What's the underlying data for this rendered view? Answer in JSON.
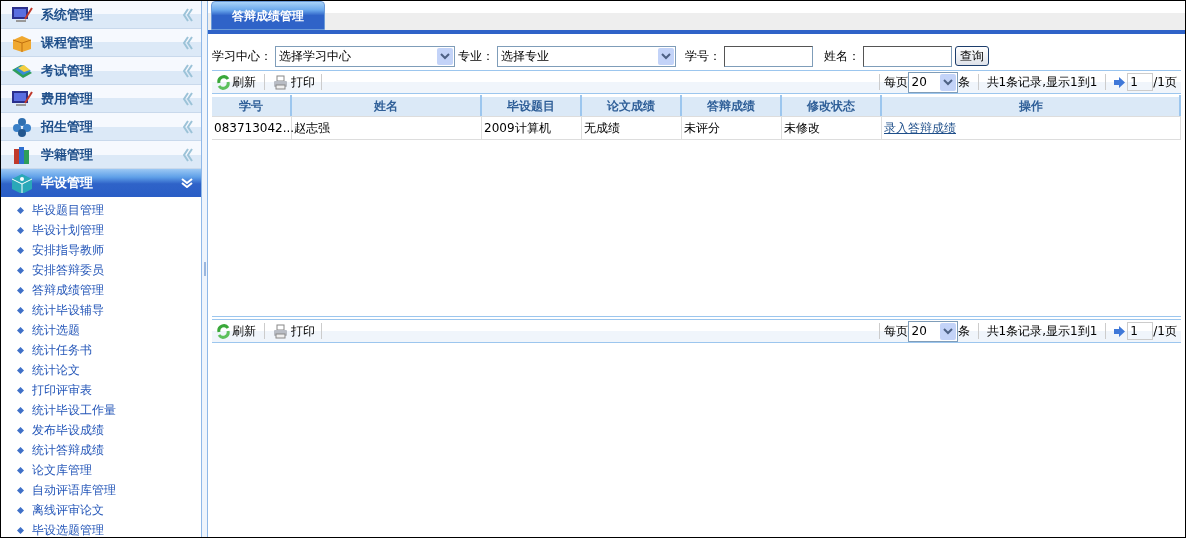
{
  "sidebar": {
    "sections": [
      {
        "label": "系统管理",
        "expanded": false
      },
      {
        "label": "课程管理",
        "expanded": false
      },
      {
        "label": "考试管理",
        "expanded": false
      },
      {
        "label": "费用管理",
        "expanded": false
      },
      {
        "label": "招生管理",
        "expanded": false
      },
      {
        "label": "学籍管理",
        "expanded": false
      },
      {
        "label": "毕设管理",
        "expanded": true,
        "children": [
          "毕设题目管理",
          "毕设计划管理",
          "安排指导教师",
          "安排答辩委员",
          "答辩成绩管理",
          "统计毕设辅导",
          "统计选题",
          "统计任务书",
          "统计论文",
          "打印评审表",
          "统计毕设工作量",
          "发布毕设成绩",
          "统计答辩成绩",
          "论文库管理",
          "自动评语库管理",
          "离线评审论文",
          "毕设选题管理"
        ]
      }
    ]
  },
  "tabs": [
    {
      "label": "答辩成绩管理",
      "selected": true
    }
  ],
  "filters": {
    "center_label": "学习中心：",
    "center_value": "选择学习中心",
    "major_label": "专业：",
    "major_value": "选择专业",
    "id_label": "学号：",
    "name_label": "姓名：",
    "search_button": "查询"
  },
  "toolbars": [
    {
      "refresh": "刷新",
      "print": "打印",
      "per_page_label": "每页",
      "per_page": "20",
      "per_page_unit": "条",
      "summary": "共1条记录,显示1到1",
      "page": "1",
      "page_total": "/1页"
    },
    {
      "refresh": "刷新",
      "print": "打印",
      "per_page_label": "每页",
      "per_page": "20",
      "per_page_unit": "条",
      "summary": "共1条记录,显示1到1",
      "page": "1",
      "page_total": "/1页"
    }
  ],
  "table": {
    "columns": [
      "学号",
      "姓名",
      "毕设题目",
      "论文成绩",
      "答辩成绩",
      "修改状态",
      "操作"
    ],
    "rows": [
      {
        "cells": [
          "083713042...",
          "赵志强",
          "2009计算机",
          "无成绩",
          "未评分",
          "未修改"
        ],
        "action": "录入答辩成绩"
      }
    ]
  }
}
